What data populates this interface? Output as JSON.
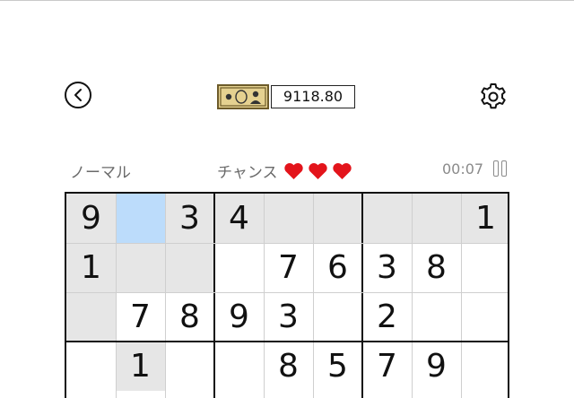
{
  "header": {
    "money_amount": "9118.80",
    "back_icon": "chevron-left-circle-icon",
    "money_icon": "banknote-icon",
    "settings_icon": "gear-icon"
  },
  "status": {
    "difficulty": "ノーマル",
    "chances_label": "チャンス",
    "chances_remaining": 3,
    "timer": "00:07"
  },
  "colors": {
    "heart": "#e3141b",
    "prefilled": "#e6e6e6",
    "selected": "#bcdcfb",
    "banknote": "#e5d190"
  },
  "board": {
    "rows": [
      [
        "9",
        "",
        "3",
        "4",
        "",
        "",
        "",
        "",
        "1"
      ],
      [
        "1",
        "",
        "",
        "",
        "7",
        "6",
        "3",
        "8",
        ""
      ],
      [
        "",
        "7",
        "8",
        "9",
        "3",
        "",
        "2",
        "",
        ""
      ],
      [
        "",
        "1",
        "",
        "",
        "8",
        "5",
        "7",
        "9",
        ""
      ]
    ],
    "shaded": [
      [
        1,
        0,
        1,
        1,
        1,
        1,
        1,
        1,
        1
      ],
      [
        1,
        1,
        1,
        0,
        0,
        0,
        0,
        0,
        0
      ],
      [
        1,
        0,
        0,
        0,
        0,
        0,
        0,
        0,
        0
      ],
      [
        0,
        1,
        0,
        0,
        0,
        0,
        0,
        0,
        0
      ]
    ],
    "selected": [
      0,
      1
    ]
  }
}
